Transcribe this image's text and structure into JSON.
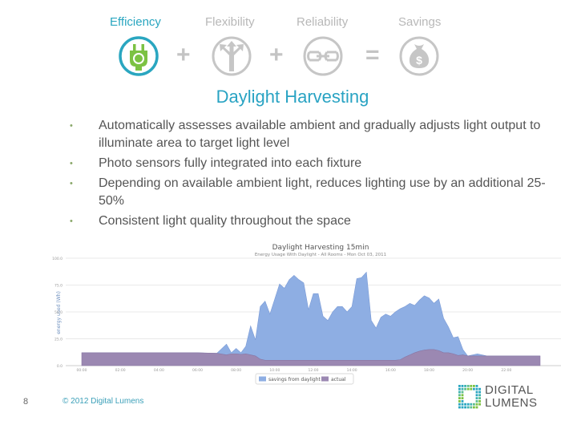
{
  "header": {
    "pillars": [
      {
        "label": "Efficiency",
        "icon": "plug-icon",
        "active": true,
        "color": "#2aa6c0",
        "icon_color": "#7cc243"
      },
      {
        "label": "Flexibility",
        "icon": "branching-arrows-icon",
        "active": false
      },
      {
        "label": "Reliability",
        "icon": "chain-link-icon",
        "active": false
      },
      {
        "label": "Savings",
        "icon": "money-bag-icon",
        "active": false
      }
    ],
    "operators": [
      "+",
      "+",
      "="
    ]
  },
  "slide": {
    "title": "Daylight Harvesting",
    "bullets": [
      "Automatically assesses available ambient and gradually adjusts light output to illuminate area to target light level",
      "Photo sensors fully integrated into each fixture",
      "Depending on available ambient light, reduces lighting use by an additional 25-50%",
      "Consistent light quality throughout the space"
    ],
    "bullet_glyph": "•"
  },
  "footer": {
    "page_number": "8",
    "copyright": "© 2012 Digital Lumens",
    "logo_line1": "DIGITAL",
    "logo_line2": "LUMENS"
  },
  "chart_data": {
    "type": "area",
    "title": "Daylight Harvesting 15min",
    "subtitle": "Energy Usage With Daylight - All Rooms - Mon Oct 03, 2011",
    "xlabel": "",
    "ylabel": "energy used (Wh)",
    "ylim": [
      0,
      100
    ],
    "yticks": [
      "0.0",
      "25.0",
      "50.0",
      "75.0",
      "100.0"
    ],
    "xticks": [
      "00:00",
      "02:00",
      "04:00",
      "06:00",
      "08:00",
      "10:00",
      "12:00",
      "14:00",
      "16:00",
      "18:00",
      "20:00",
      "22:00"
    ],
    "xlim_hours": [
      0,
      24
    ],
    "grid": true,
    "stacked": true,
    "legend_position": "bottom",
    "colors": {
      "savings from daylight": "#8eaee3",
      "actual": "#9b88b2"
    },
    "x_hours": [
      0,
      1,
      2,
      3,
      4,
      5,
      6,
      7,
      7.5,
      7.75,
      8,
      8.25,
      8.5,
      8.75,
      9,
      9.25,
      9.5,
      9.75,
      10,
      10.25,
      10.5,
      10.75,
      11,
      11.25,
      11.5,
      11.75,
      12,
      12.25,
      12.5,
      12.75,
      13,
      13.25,
      13.5,
      13.75,
      14,
      14.25,
      14.5,
      14.75,
      15,
      15.25,
      15.5,
      15.75,
      16,
      16.25,
      16.5,
      16.75,
      17,
      17.25,
      17.5,
      17.75,
      18,
      18.25,
      18.5,
      18.75,
      19,
      19.25,
      19.5,
      19.75,
      20,
      20.5,
      21,
      21.5,
      22,
      22.5,
      23,
      23.75
    ],
    "series": [
      {
        "name": "actual",
        "values": [
          12,
          12,
          12,
          12,
          12,
          12,
          12,
          11.5,
          10,
          11,
          11,
          10.5,
          11,
          10,
          9,
          6,
          5,
          5,
          5,
          5,
          5,
          5,
          5,
          5,
          5,
          5,
          5,
          5,
          5,
          5,
          5,
          5,
          5,
          5,
          5,
          5,
          5,
          5,
          5,
          5,
          5,
          5,
          5,
          5,
          5.5,
          8,
          10,
          12,
          13.5,
          14.5,
          15,
          15,
          14,
          12,
          12,
          11,
          9.5,
          10,
          9,
          9,
          9,
          9,
          9,
          9,
          9,
          9
        ]
      },
      {
        "name": "savings from daylight",
        "total_values": [
          12,
          12,
          12,
          12,
          12,
          12,
          12,
          11.5,
          20,
          12,
          16,
          12,
          18,
          37,
          24,
          55,
          60,
          48,
          62,
          76,
          72,
          80,
          84,
          80,
          77,
          52,
          67,
          67,
          46,
          42,
          50,
          55,
          55,
          50,
          55,
          81,
          82,
          87,
          42,
          35,
          45,
          48,
          46,
          50,
          53,
          55,
          58,
          56,
          61,
          65,
          63,
          58,
          62,
          44,
          36,
          26,
          27,
          15,
          9,
          11,
          9,
          7,
          9,
          8,
          9,
          9
        ]
      }
    ]
  }
}
